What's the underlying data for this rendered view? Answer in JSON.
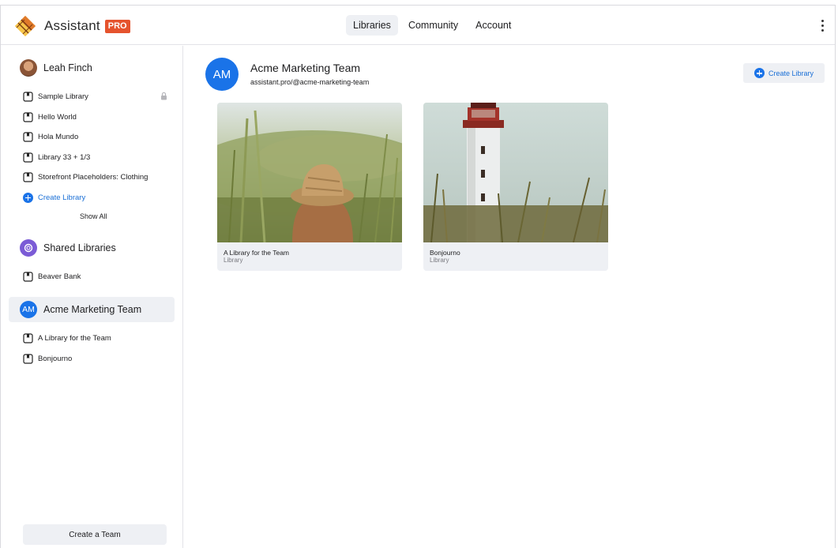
{
  "app": {
    "name": "Assistant",
    "badge": "PRO"
  },
  "nav": {
    "tabs": [
      {
        "label": "Libraries",
        "active": true
      },
      {
        "label": "Community"
      },
      {
        "label": "Account"
      }
    ]
  },
  "sidebar": {
    "user": {
      "name": "Leah Finch",
      "libraries": [
        {
          "label": "Sample Library",
          "locked": true
        },
        {
          "label": "Hello World"
        },
        {
          "label": "Hola Mundo"
        },
        {
          "label": "Library 33 + 1/3"
        },
        {
          "label": "Storefront Placeholders: Clothing"
        }
      ],
      "create_label": "Create Library",
      "show_all_label": "Show All"
    },
    "shared": {
      "title": "Shared Libraries",
      "libraries": [
        {
          "label": "Beaver Bank"
        }
      ]
    },
    "team": {
      "initials": "AM",
      "name": "Acme Marketing Team",
      "libraries": [
        {
          "label": "A Library for the Team"
        },
        {
          "label": "Bonjourno"
        }
      ]
    },
    "create_team_label": "Create a Team"
  },
  "main": {
    "team_initials": "AM",
    "team_name": "Acme Marketing Team",
    "team_handle": "assistant.pro/@acme-marketing-team",
    "create_library_label": "Create Library",
    "cards": [
      {
        "title": "A Library for the Team",
        "subtitle": "Library"
      },
      {
        "title": "Bonjourno",
        "subtitle": "Library"
      }
    ]
  },
  "colors": {
    "accent": "#1a73e8",
    "badge": "#e5532d",
    "selected_bg": "#eef0f4",
    "shared_avatar": "#7b5bd6"
  }
}
